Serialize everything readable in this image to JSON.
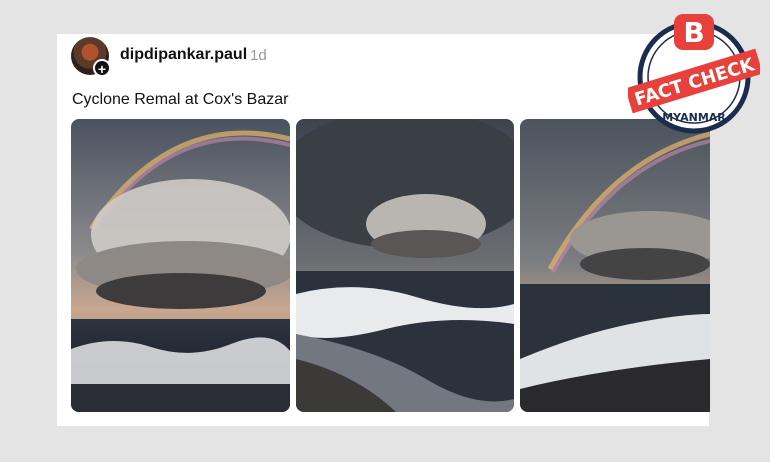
{
  "post": {
    "username": "dipdipankar.paul",
    "time": "1d",
    "caption": "Cyclone Remal at Cox's Bazar",
    "avatar_badge": "+"
  },
  "photos": [
    {
      "name": "photo-1"
    },
    {
      "name": "photo-2"
    },
    {
      "name": "photo-3"
    }
  ],
  "badge": {
    "logo_letter": "B",
    "line1": "FACT CHECK",
    "line2": "MYANMAR",
    "colors": {
      "red": "#e8413c",
      "navy": "#1d2b4f"
    }
  }
}
